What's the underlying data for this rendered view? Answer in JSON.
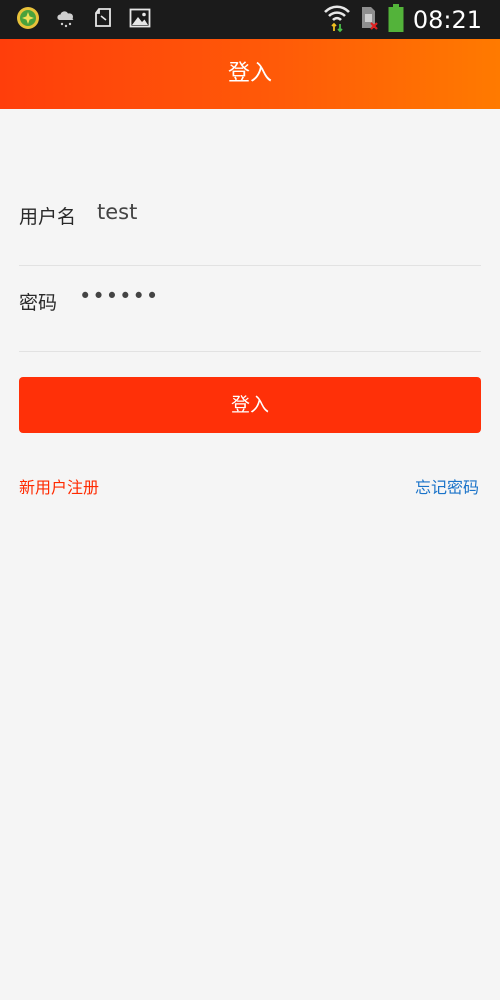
{
  "status_bar": {
    "time": "08:21",
    "left_icons": [
      "app-badge-icon",
      "cloud-rain-icon",
      "file-icon",
      "image-icon"
    ],
    "right_icons": [
      "wifi-icon",
      "sim-no-signal-icon",
      "battery-icon"
    ]
  },
  "header": {
    "title": "登入"
  },
  "form": {
    "username_label": "用户名",
    "username_value": "test",
    "password_label": "密码",
    "password_value": "••••••"
  },
  "actions": {
    "login_label": "登入",
    "register_label": "新用户注册",
    "forgot_label": "忘记密码"
  },
  "colors": {
    "accent": "#ff3008",
    "header_gradient_start": "#ff3e0b",
    "header_gradient_end": "#ff7a00",
    "register_link": "#ff2a00",
    "forgot_link": "#1a73c9",
    "background": "#f5f5f5"
  }
}
